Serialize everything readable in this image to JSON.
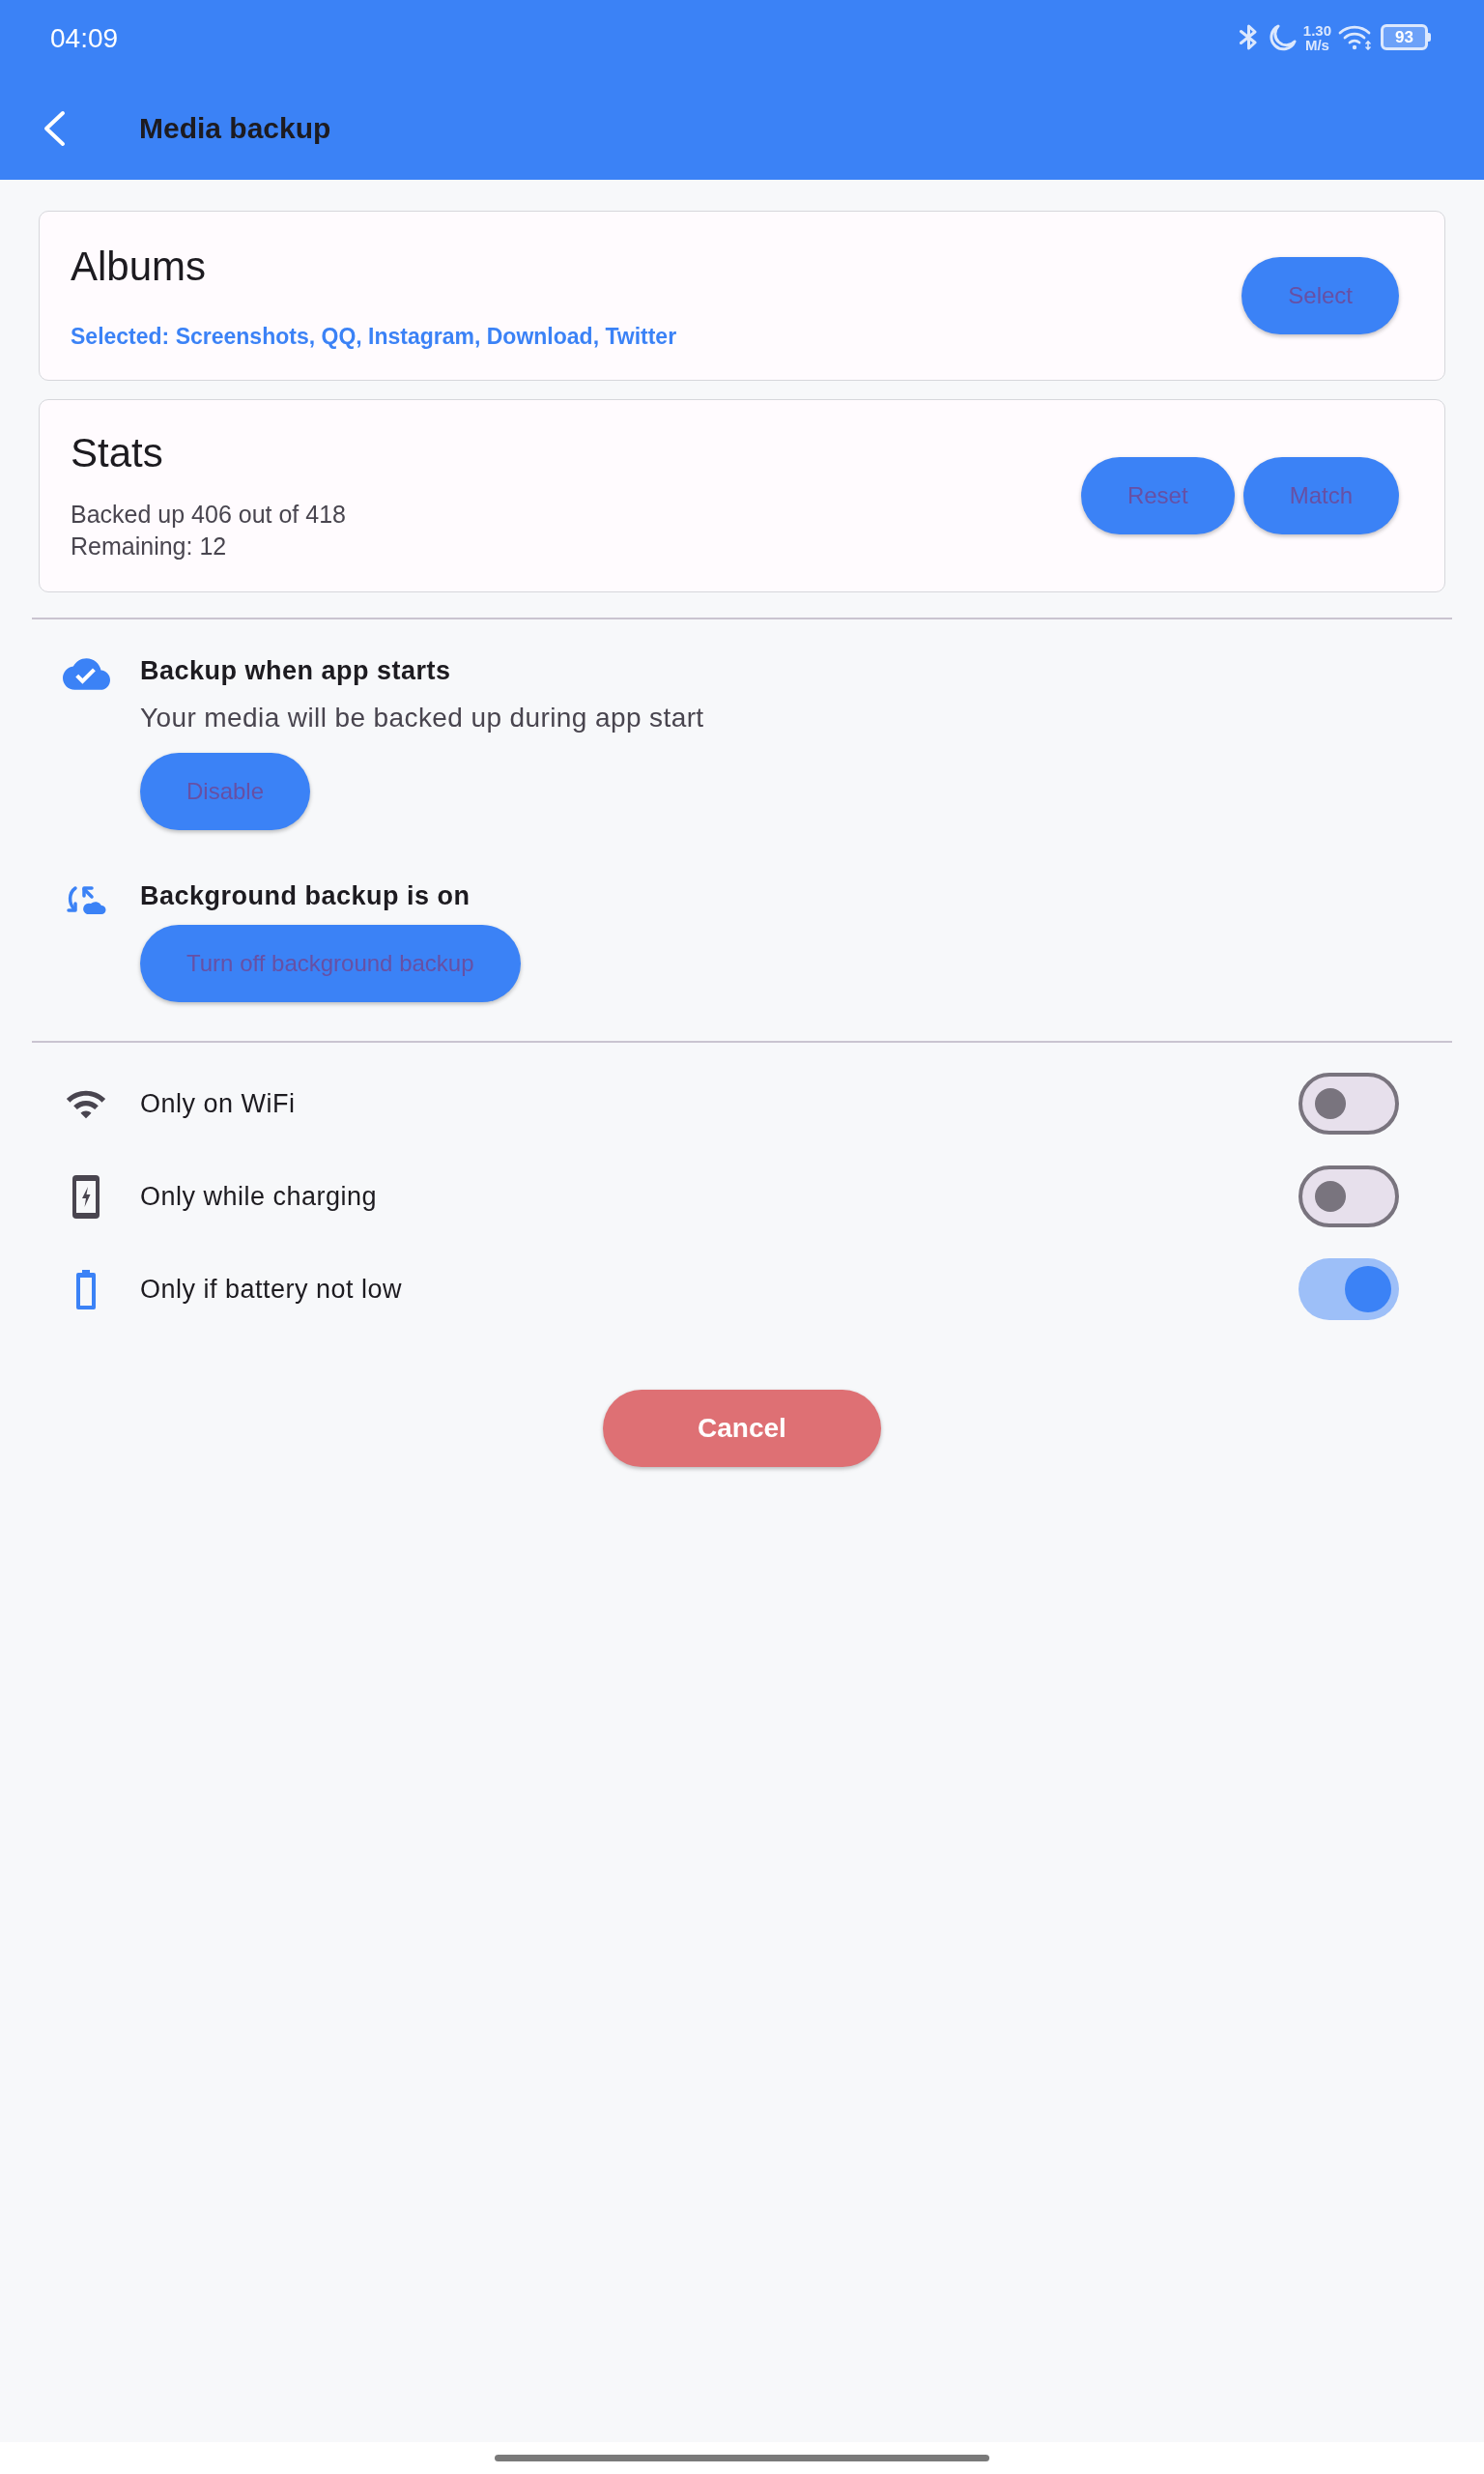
{
  "status_bar": {
    "time": "04:09",
    "speed_value": "1.30",
    "speed_unit": "M/s",
    "battery": "93"
  },
  "app_bar": {
    "title": "Media backup"
  },
  "albums": {
    "title": "Albums",
    "selection_summary": "Selected: Screenshots, QQ, Instagram, Download, Twitter",
    "button": "Select"
  },
  "stats": {
    "title": "Stats",
    "lines": [
      "Backed up 406 out of 418",
      "Remaining: 12"
    ],
    "buttons": [
      "Reset",
      "Match"
    ]
  },
  "backup_options": [
    {
      "kind": "app-start",
      "title": "Backup when app starts",
      "description": "Your media will be backed up during app start",
      "button": "Disable"
    },
    {
      "kind": "background",
      "title": "Background backup is on",
      "button": "Turn off background backup"
    }
  ],
  "constraints": [
    {
      "kind": "wifi",
      "label": "Only on WiFi",
      "on": false
    },
    {
      "kind": "charging",
      "label": "Only while charging",
      "on": false
    },
    {
      "kind": "battery",
      "label": "Only if battery not low",
      "on": true
    }
  ],
  "cancel_button": "Cancel"
}
